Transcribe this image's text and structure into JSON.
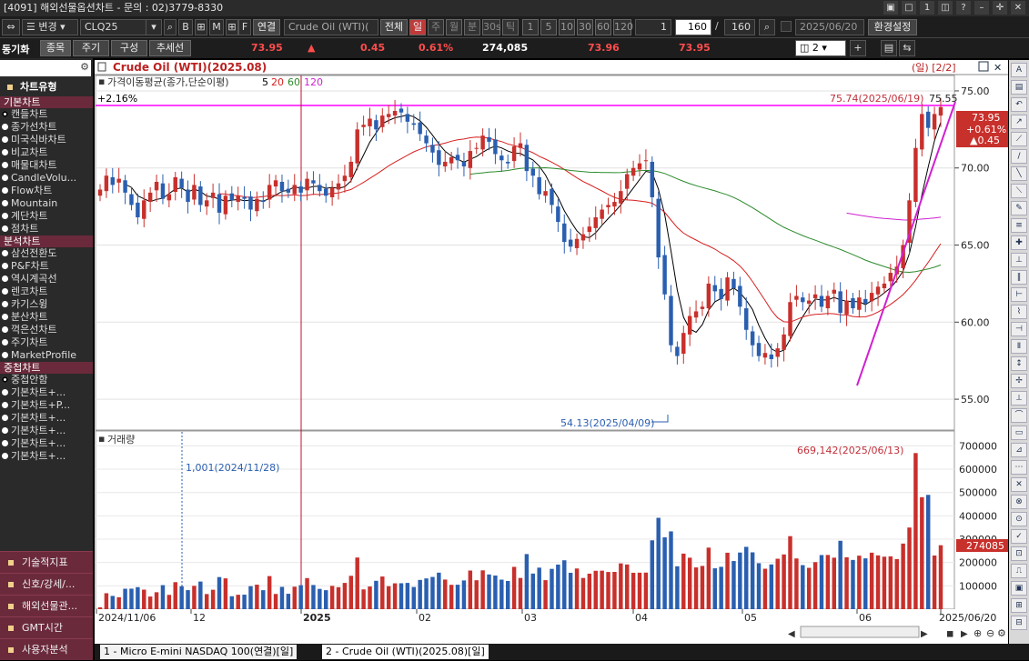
{
  "window": {
    "title": "[4091] 해외선물옵션차트 - 문의 : 02)3779-8330"
  },
  "toolbar1": {
    "mode": "변경",
    "symbol": "CLQ25",
    "q": "Q",
    "b": "B",
    "m": "M",
    "f": "F",
    "link": "연결",
    "product": "Crude Oil (WTI)(",
    "all": "전체",
    "periods": [
      "일",
      "주",
      "월",
      "분",
      "30s",
      "틱"
    ],
    "nums": [
      "1",
      "5",
      "10",
      "30",
      "60",
      "120"
    ],
    "count_a": "1",
    "count_b": "160",
    "count_c": "160",
    "date": "2025/06/20",
    "settings": "환경설정"
  },
  "toolbar2": {
    "sync": "동기화",
    "tabs": [
      "종목",
      "주기",
      "구성",
      "추세선"
    ],
    "price": "73.95",
    "arrow": "▲",
    "change": "0.45",
    "pct": "0.61%",
    "volume": "274,085",
    "p1": "73.96",
    "p2": "73.95",
    "panes": "2"
  },
  "sidebar": {
    "header": "차트유형",
    "sections": [
      {
        "title": "기본차트",
        "items": [
          "캔들차트",
          "종가선차트",
          "미국식바차트",
          "비교차트",
          "매물대차트",
          "CandleVolu...",
          "Flow차트",
          "Mountain",
          "계단차트",
          "점차트"
        ]
      },
      {
        "title": "분석차트",
        "items": [
          "삼선전환도",
          "P&F차트",
          "역시계곡선",
          "렌코차트",
          "카기스윙",
          "분산차트",
          "꺽은선차트",
          "주기차트",
          "MarketProfile"
        ]
      },
      {
        "title": "중첩차트",
        "items": [
          "중첩안함",
          "기본차트+...",
          "기본차트+P...",
          "기본차트+...",
          "기본차트+...",
          "기본차트+...",
          "기본차트+..."
        ]
      }
    ],
    "bottom": [
      "기술적지표",
      "신호/강세/...",
      "해외선물관...",
      "GMT시간",
      "사용자분석"
    ]
  },
  "chart": {
    "title": "Crude Oil (WTI)(2025.08)",
    "period_label": "(일) [2/2]",
    "ma_label": "가격이동평균(종가,단순이평)",
    "ma_periods": [
      "5",
      "20",
      "60",
      "120"
    ],
    "pct_label": "+2.16%",
    "high_label": "75.74(2025/06/19)",
    "high_right": "75.55",
    "low_label": "54.13(2025/04/09)",
    "price_box": [
      "73.95",
      "+0.61%",
      "▲0.45"
    ],
    "volume_title": "거래량",
    "vol_max_label": "669,142(2025/06/13)",
    "vol_min_label": "1,001(2024/11/28)",
    "vol_current": "274085",
    "price_axis": [
      "75.00",
      "70.00",
      "65.00",
      "60.00",
      "55.00"
    ],
    "volume_axis": [
      "700000",
      "600000",
      "500000",
      "400000",
      "300000",
      "200000",
      "100000"
    ],
    "x_axis": [
      "2024/11/06",
      "12",
      "2025",
      "02",
      "03",
      "04",
      "05",
      "06",
      "2025/06/20"
    ],
    "colors": {
      "up": "#c8302c",
      "down": "#2a5fb0",
      "ma5": "#000000",
      "ma20": "#d62020",
      "ma60": "#2a8a2a",
      "ma120": "#d020d0",
      "hline": "#ff00ff"
    }
  },
  "chart_data": {
    "type": "candlestick",
    "series": [
      {
        "name": "Crude Oil (WTI)(2025.08)",
        "close": [
          68.6,
          69.5,
          68.9,
          69.3,
          68.4,
          67.6,
          66.8,
          67.9,
          68.4,
          69.1,
          68.0,
          68.3,
          69.4,
          68.7,
          67.8,
          68.9,
          67.6,
          67.9,
          68.4,
          67.1,
          68.2,
          67.9,
          68.2,
          68.0,
          67.3,
          68.0,
          67.8,
          68.9,
          69.2,
          68.5,
          68.4,
          68.9,
          68.4,
          69.3,
          69.0,
          68.5,
          68.2,
          68.7,
          69.0,
          69.5,
          70.4,
          72.5,
          72.8,
          73.2,
          72.5,
          73.4,
          73.5,
          73.7,
          73.6,
          73.0,
          72.8,
          72.2,
          71.6,
          71.0,
          70.2,
          70.4,
          70.7,
          70.5,
          70.1,
          71.1,
          71.3,
          72.1,
          71.7,
          70.9,
          70.5,
          70.3,
          71.4,
          71.6,
          69.8,
          69.5,
          68.3,
          68.5,
          67.6,
          66.5,
          65.2,
          64.9,
          65.4,
          65.7,
          66.2,
          66.8,
          67.3,
          67.6,
          67.8,
          68.5,
          69.6,
          70.0,
          70.3,
          70.5,
          68.1,
          64.2,
          61.8,
          58.5,
          57.8,
          59.3,
          60.4,
          60.7,
          61.0,
          62.5,
          62.0,
          61.5,
          62.9,
          62.2,
          61.0,
          59.5,
          58.5,
          57.8,
          58.0,
          57.6,
          58.3,
          59.2,
          61.3,
          61.7,
          61.3,
          61.4,
          61.8,
          61.0,
          61.7,
          62.1,
          60.6,
          61.4,
          60.9,
          61.6,
          61.2,
          61.9,
          62.3,
          62.5,
          63.2,
          63.6,
          65.0,
          67.9,
          71.3,
          73.5,
          72.6,
          73.5,
          73.95
        ]
      }
    ],
    "x_start": "2024/11/06",
    "x_end": "2025/06/20",
    "ylim": [
      53,
      76
    ],
    "high": {
      "value": 75.74,
      "date": "2025/06/19"
    },
    "low": {
      "value": 54.13,
      "date": "2025/04/09"
    },
    "volume": {
      "max": {
        "value": 669142,
        "date": "2025/06/13"
      },
      "min": {
        "value": 1001,
        "date": "2024/11/28"
      },
      "current": 274085
    }
  }
}
